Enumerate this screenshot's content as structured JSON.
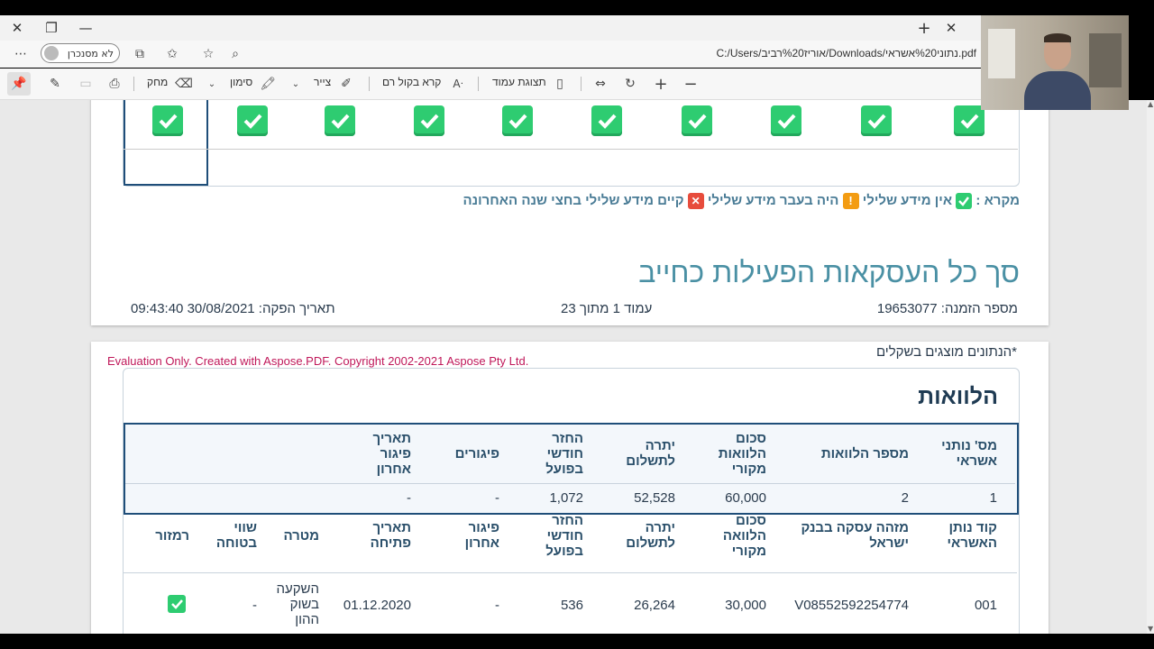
{
  "browser": {
    "profile_label": "לא מסנכרן",
    "url": "C:/Users/אוריז%20רביב/Downloads/נתוני%20אשראי.pdf",
    "toolbar": {
      "erase": "מחק",
      "highlight": "סימון",
      "draw": "צייר",
      "read_aloud": "קרא בקול רם",
      "page_view": "תצוגת עמוד"
    }
  },
  "page1": {
    "legend": {
      "prefix": "מקרא :",
      "no_negative": "אין מידע שלילי",
      "past_negative": "היה בעבר מידע שלילי",
      "recent_negative": "קיים מידע שלילי בחצי שנה האחרונה"
    },
    "title": "סך כל העסקאות הפעילות כחייב",
    "order_number": "מספר הזמנה: 19653077",
    "page_info": "עמוד 1 מתוך 23",
    "issue_date": "תאריך הפקה: 30/08/2021 09:43:40"
  },
  "page2": {
    "note": "*הנתונים מוצגים בשקלים",
    "watermark": "Evaluation Only. Created with Aspose.PDF. Copyright 2002-2021 Aspose Pty Ltd.",
    "section_title": "הלוואות",
    "summary_headers": [
      "מס' נותני אשראי",
      "מספר הלוואות",
      "סכום הלוואות מקורי",
      "יתרה לתשלום",
      "החזר חודשי בפועל",
      "פיגורים",
      "תאריך פיגור אחרון"
    ],
    "summary_row": [
      "1",
      "2",
      "60,000",
      "52,528",
      "1,072",
      "-",
      "-"
    ],
    "detail_headers": [
      "קוד נותן האשראי",
      "מזהה עסקה בבנק ישראל",
      "סכום הלוואה מקורי",
      "יתרה לתשלום",
      "החזר חודשי בפועל",
      "פיגור אחרון",
      "תאריך פתיחה",
      "מטרה",
      "שווי בטוחה",
      "רמזור"
    ],
    "detail_row": [
      "001",
      "V08552592254774",
      "30,000",
      "26,264",
      "536",
      "-",
      "01.12.2020",
      "השקעה בשוק ההון",
      "-"
    ]
  },
  "colors": {
    "check_green": "#2ecc71",
    "warn_orange": "#f39c12",
    "error_red": "#e74c3c",
    "title_teal": "#4a90a4",
    "table_border": "#1f4e79",
    "watermark": "#c0185a"
  }
}
